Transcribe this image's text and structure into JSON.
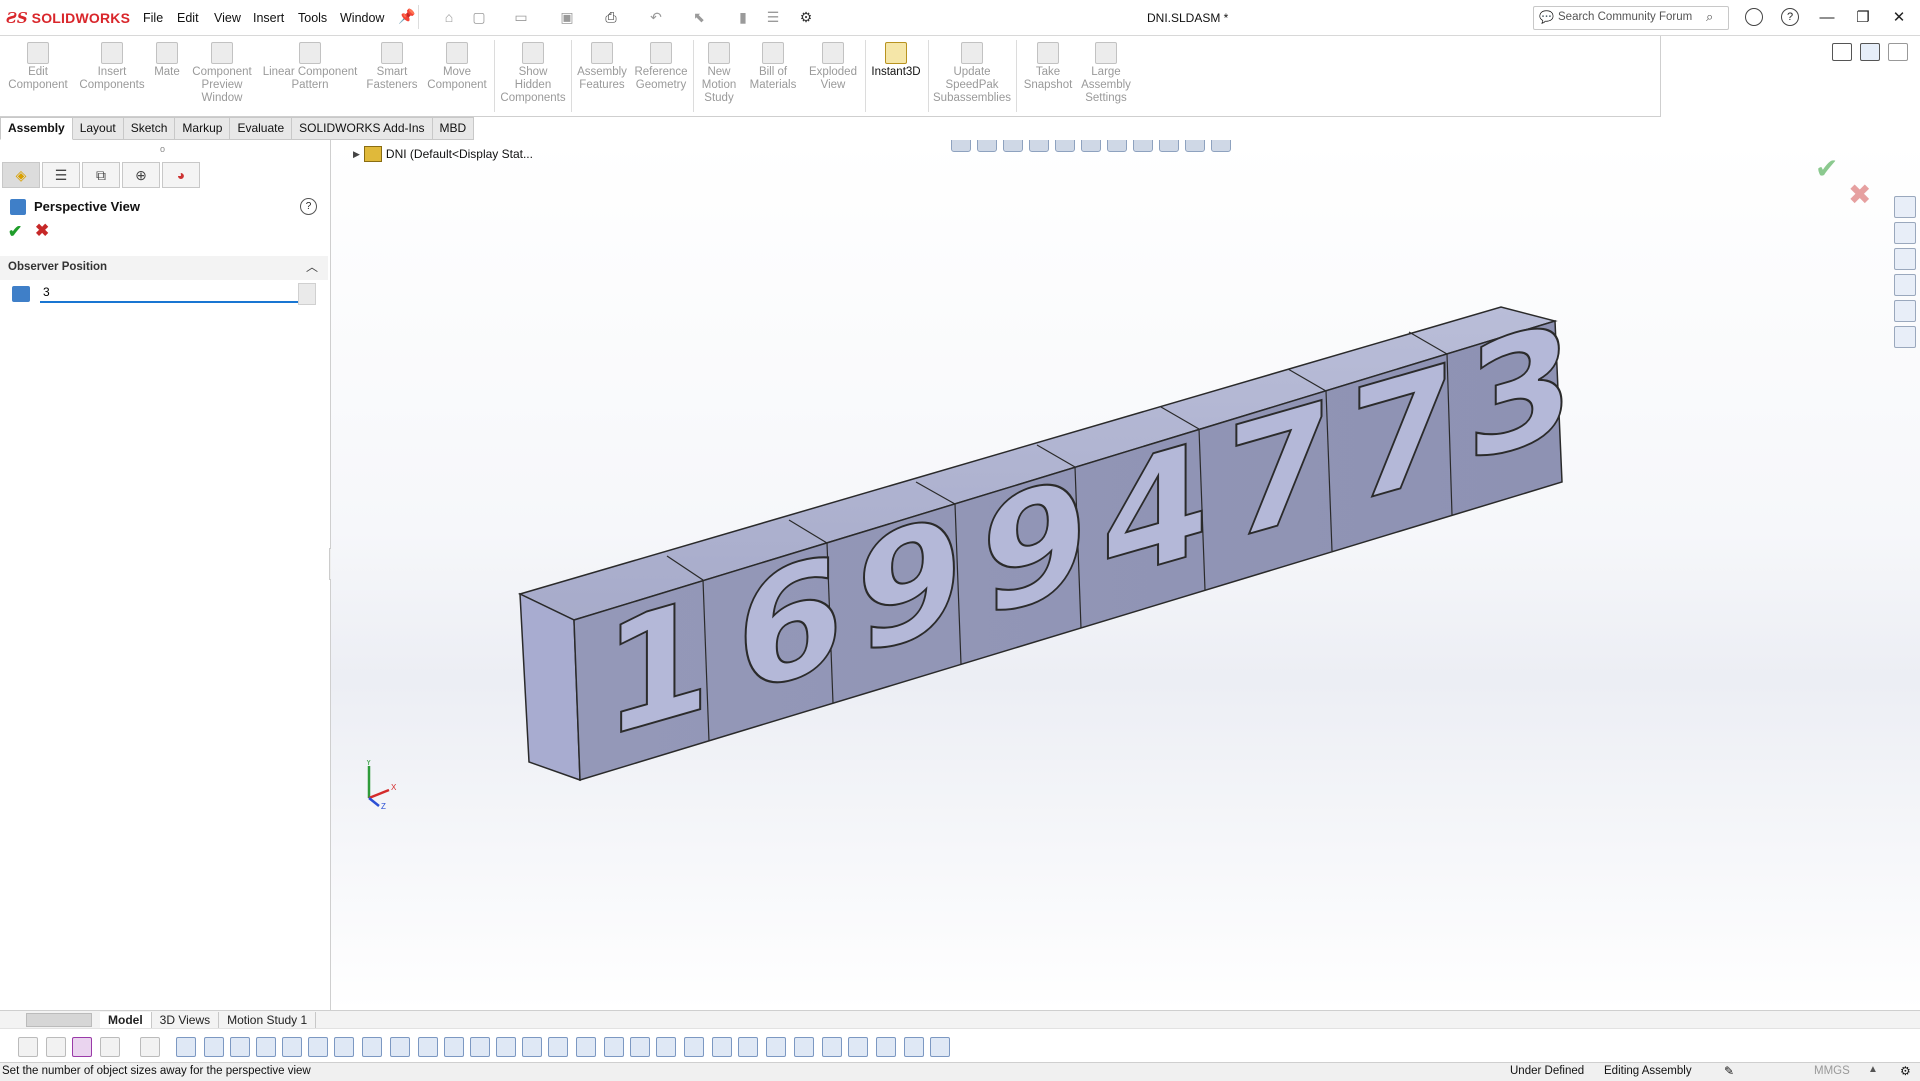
{
  "app": {
    "logo_ds": "ƧS",
    "logo_name": "SOLIDWORKS"
  },
  "menu": [
    "File",
    "Edit",
    "View",
    "Insert",
    "Tools",
    "Window"
  ],
  "document_title": "DNI.SLDASM *",
  "search": {
    "placeholder": "Search Community Forum"
  },
  "commands": [
    {
      "label": "Edit\nComponent"
    },
    {
      "label": "Insert\nComponents"
    },
    {
      "label": "Mate"
    },
    {
      "label": "Component\nPreview\nWindow"
    },
    {
      "label": "Linear Component\nPattern"
    },
    {
      "label": "Smart\nFasteners"
    },
    {
      "label": "Move\nComponent"
    },
    {
      "label": "Show\nHidden\nComponents"
    },
    {
      "label": "Assembly\nFeatures"
    },
    {
      "label": "Reference\nGeometry"
    },
    {
      "label": "New\nMotion\nStudy"
    },
    {
      "label": "Bill of\nMaterials"
    },
    {
      "label": "Exploded\nView"
    },
    {
      "label": "Instant3D"
    },
    {
      "label": "Update\nSpeedPak\nSubassemblies"
    },
    {
      "label": "Take\nSnapshot"
    },
    {
      "label": "Large\nAssembly\nSettings"
    }
  ],
  "tabs": [
    "Assembly",
    "Layout",
    "Sketch",
    "Markup",
    "Evaluate",
    "SOLIDWORKS Add-Ins",
    "MBD"
  ],
  "property_manager": {
    "title": "Perspective View",
    "help": "?",
    "section_title": "Observer Position",
    "observer_value": "3"
  },
  "tree": {
    "root_label": "DNI  (Default<Display Stat..."
  },
  "model_digits": [
    "1",
    "6",
    "9",
    "9",
    "4",
    "7",
    "7",
    "3"
  ],
  "bottom_tabs": [
    "Model",
    "3D Views",
    "Motion Study 1"
  ],
  "status": {
    "message": "Set the number of object sizes away for the perspective view",
    "definition": "Under Defined",
    "mode": "Editing Assembly",
    "units": "MMGS"
  },
  "triad_labels": {
    "x": "X",
    "y": "Y",
    "z": "Z"
  },
  "icons": {
    "viewport_ok": "check-icon",
    "viewport_cancel": "close-icon"
  }
}
